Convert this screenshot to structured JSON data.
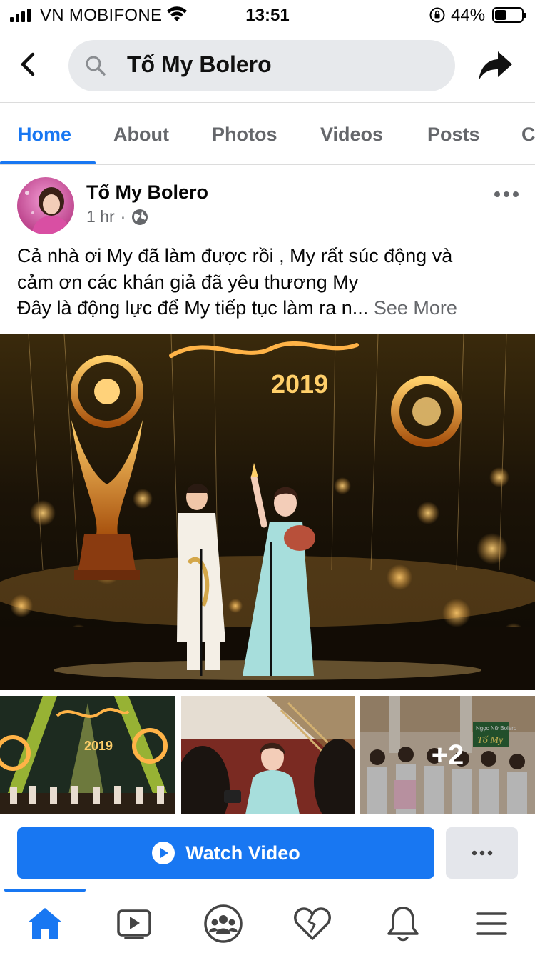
{
  "status_bar": {
    "carrier": "VN MOBIFONE",
    "time": "13:51",
    "battery_percent": "44%",
    "battery_level": 0.44
  },
  "search": {
    "query": "Tố My Bolero"
  },
  "tabs": [
    {
      "label": "Home",
      "active": true
    },
    {
      "label": "About",
      "active": false
    },
    {
      "label": "Photos",
      "active": false
    },
    {
      "label": "Videos",
      "active": false
    },
    {
      "label": "Posts",
      "active": false
    },
    {
      "label": "C",
      "active": false
    }
  ],
  "post": {
    "author": "Tố My Bolero",
    "time": "1 hr",
    "separator": "·",
    "text_lines": [
      "Cả nhà ơi My đã làm được rồi , My rất súc động và",
      "cảm ơn các khán giả đã yêu thương My",
      "Đây là động lực để My tiếp tục làm ra n..."
    ],
    "see_more": "See More",
    "photo_main_text": "2019",
    "thumb1_text": "2019",
    "thumb3_sign_line1": "Ngọc Nữ Bolero",
    "thumb3_sign_line2": "Tố My",
    "extra_photos": "+2"
  },
  "actions": {
    "watch_video": "Watch Video"
  },
  "colors": {
    "accent": "#1877f2",
    "muted": "#65676b",
    "button_gray": "#e4e6eb"
  },
  "icons": {
    "back": "chevron-left-icon",
    "search": "search-icon",
    "share": "share-arrow-icon",
    "more": "more-dots-icon",
    "globe": "globe-icon",
    "play": "play-circle-icon",
    "nav": [
      "home-icon",
      "watch-icon",
      "groups-icon",
      "dating-heart-icon",
      "bell-icon",
      "menu-icon"
    ]
  }
}
